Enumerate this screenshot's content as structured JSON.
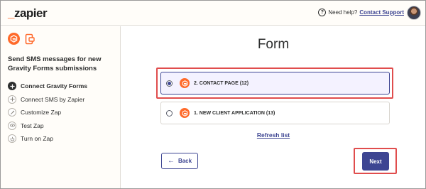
{
  "header": {
    "logo_text": "zapier",
    "help_text": "Need help?",
    "help_link": "Contact Support",
    "accent_color": "#ff4a00"
  },
  "sidebar": {
    "title": "Send SMS messages for new Gravity Forms submissions",
    "app_icons": [
      "gravity-forms-icon",
      "sms-by-zapier-icon"
    ],
    "steps": [
      {
        "label": "Connect Gravity Forms",
        "icon": "plus-icon",
        "active": true
      },
      {
        "label": "Connect SMS by Zapier",
        "icon": "plus-icon",
        "active": false
      },
      {
        "label": "Customize Zap",
        "icon": "pencil-icon",
        "active": false
      },
      {
        "label": "Test Zap",
        "icon": "eye-icon",
        "active": false
      },
      {
        "label": "Turn on Zap",
        "icon": "power-icon",
        "active": false
      }
    ]
  },
  "main": {
    "title": "Form",
    "options": [
      {
        "label": "2. CONTACT PAGE (12)",
        "selected": true
      },
      {
        "label": "1. NEW CLIENT APPLICATION (13)",
        "selected": false
      }
    ],
    "refresh_label": "Refresh list",
    "back_label": "Back",
    "next_label": "Next"
  },
  "colors": {
    "primary": "#3d4592",
    "highlight": "#e04d4d",
    "app_orange": "#ff6a2a"
  }
}
